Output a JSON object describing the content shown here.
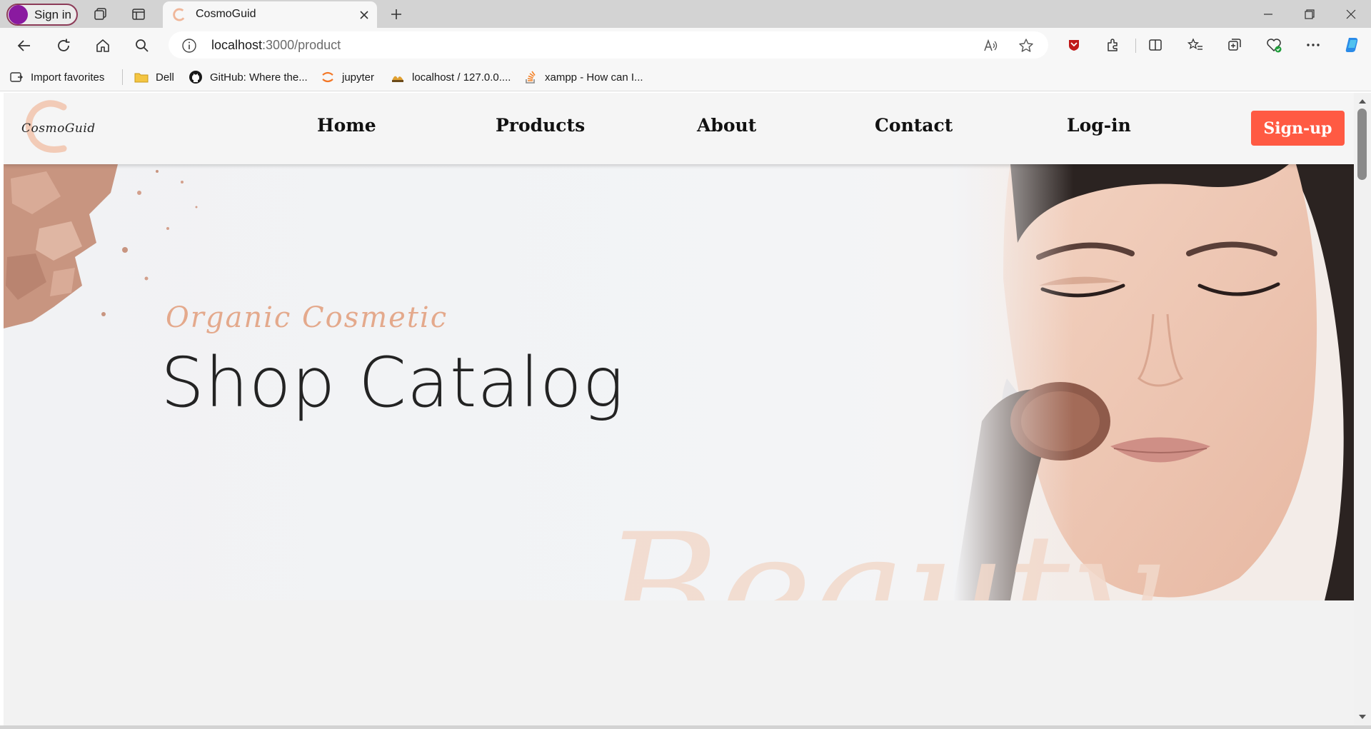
{
  "browser": {
    "profile_label": "Sign in",
    "tab_title": "CosmoGuid",
    "address_host": "localhost",
    "address_path": ":3000/product",
    "bookmarks": [
      {
        "label": "Import favorites",
        "icon": "import-icon"
      },
      {
        "label": "Dell",
        "icon": "folder-icon"
      },
      {
        "label": "GitHub: Where the...",
        "icon": "github-icon"
      },
      {
        "label": "jupyter",
        "icon": "jupyter-icon"
      },
      {
        "label": "localhost / 127.0.0....",
        "icon": "phpmyadmin-icon"
      },
      {
        "label": "xampp - How can I...",
        "icon": "stackoverflow-icon"
      }
    ]
  },
  "site": {
    "logo_text": "CosmoGuid",
    "nav": [
      {
        "label": "Home"
      },
      {
        "label": "Products"
      },
      {
        "label": "About"
      },
      {
        "label": "Contact"
      },
      {
        "label": "Log-in"
      }
    ],
    "signup_label": "Sign-up",
    "accent_color": "#ff5a43"
  },
  "hero": {
    "kicker": "Organic Cosmetic",
    "title": "Shop Catalog",
    "watermark": "Beauty"
  }
}
